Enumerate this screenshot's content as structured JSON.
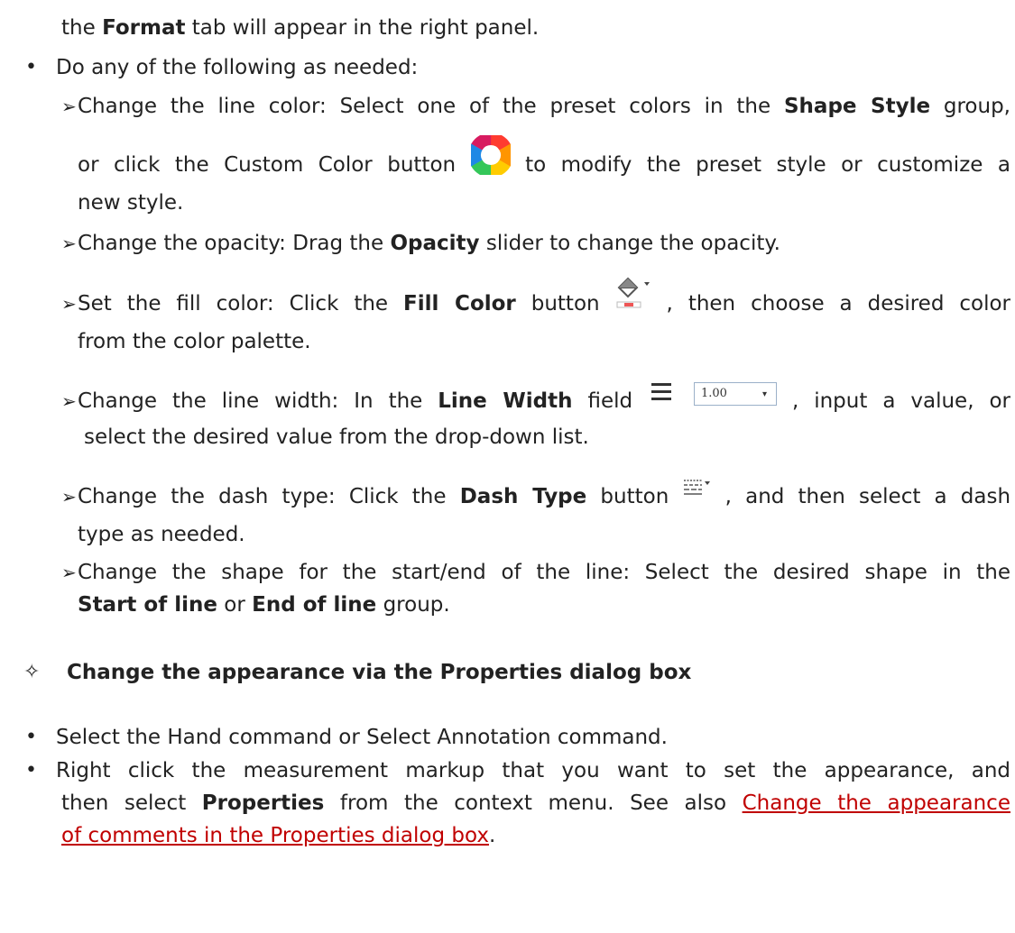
{
  "l1": {
    "a": "the ",
    "b": "Format",
    "c": " tab will appear in the right panel."
  },
  "l2": "Do any of the following as needed:",
  "l3": {
    "a": "Change the line color: Select one of the preset colors in the ",
    "b": "Shape Style",
    "c": " group,"
  },
  "l4": {
    "a": "or click the Custom Color button",
    "b": "to modify the preset style or customize a"
  },
  "l5": "new style.",
  "l6": {
    "a": "Change the opacity: Drag the ",
    "b": "Opacity",
    "c": " slider to change the opacity."
  },
  "l7": {
    "a": "Set the fill color: Click the ",
    "b": "Fill Color",
    "c": " button",
    "d": ", then choose a desired color"
  },
  "l8": "from the color palette.",
  "l9": {
    "a": "Change the line width: In the ",
    "b": "Line Width",
    "c": " field",
    "d": ", input a value, or"
  },
  "line_width_value": "1.00",
  "l10": "select the desired value from the drop-down list.",
  "l11": {
    "a": "Change the dash type: Click the ",
    "b": "Dash Type",
    "c": " button",
    "d": ", and then select a dash"
  },
  "l12": "type as needed.",
  "l13": "Change the shape for the start/end of the line: Select the desired shape in the",
  "l14": {
    "a": "Start of line",
    "b": " or ",
    "c": "End of line",
    "d": " group."
  },
  "heading": "Change the appearance via the Properties dialog box",
  "l15": "Select the Hand command or Select Annotation command.",
  "l16": "Right click the measurement markup that you want to set the appearance, and",
  "l17": {
    "a": "then select ",
    "b": "Properties",
    "c": " from the context menu. See also ",
    "d": "Change the appearance"
  },
  "l18": {
    "a": "of comments in the Properties dialog box",
    "b": "."
  },
  "icons": {
    "bullet": "•",
    "sub_bullet": "➢",
    "heading_marker": "✧"
  }
}
